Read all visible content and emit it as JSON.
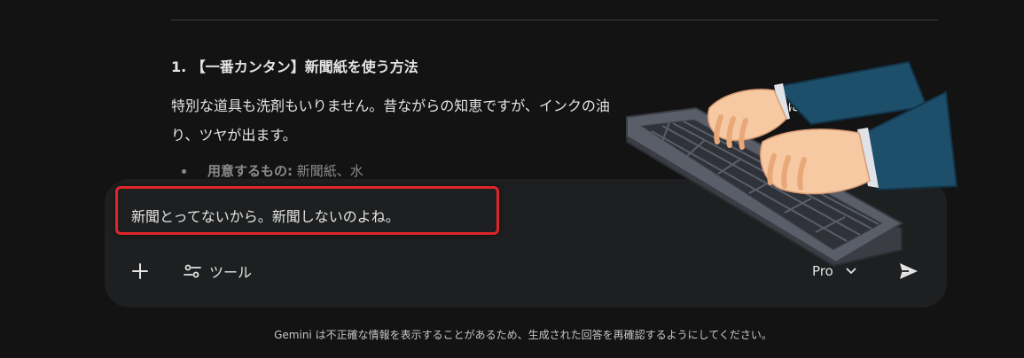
{
  "content": {
    "heading": "1. 【一番カンタン】新聞紙を使う方法",
    "paragraph_line1": "特別な道具も洗剤もいりません。昔ながらの知恵ですが、インクの油",
    "paragraph_line1_tail": "にな",
    "paragraph_line2": "り、ツヤが出ます。",
    "bullet_label": "用意するもの:",
    "bullet_value": " 新聞紙、水"
  },
  "input": {
    "text": "新聞とってないから。新聞しないのよね。"
  },
  "toolbar": {
    "add_icon": "plus-icon",
    "tools_label": "ツール",
    "tools_icon": "tune-icon",
    "model_label": "Pro",
    "model_icon": "chevron-down-icon",
    "send_icon": "send-icon"
  },
  "footer": {
    "disclaimer": "Gemini は不正確な情報を表示することがあるため、生成された回答を再確認するようにしてください。"
  },
  "colors": {
    "background": "#131314",
    "input_bg": "#1e1f20",
    "highlight_border": "#e0242a",
    "text": "#e3e3e3"
  }
}
